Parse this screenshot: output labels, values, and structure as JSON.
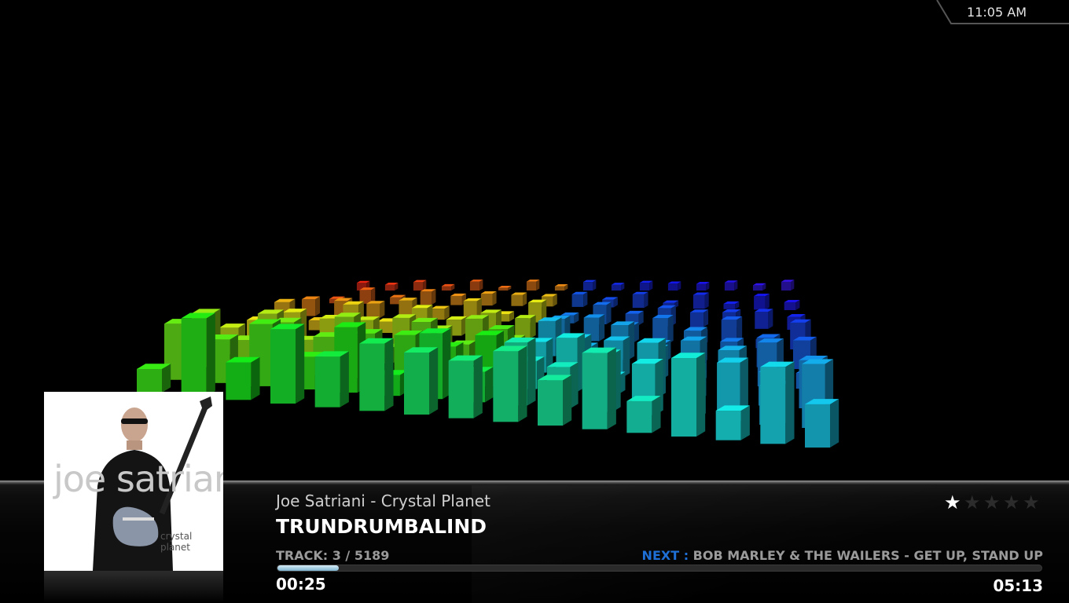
{
  "clock": {
    "time": "11:05 AM"
  },
  "album_art": {
    "artist_text": "joe satriani",
    "album_text": "crystal planet"
  },
  "now_playing": {
    "artist_album": "Joe Satriani - Crystal Planet",
    "title": "TRUNDRUMBALIND",
    "track": "TRACK: 3 / 5189",
    "next_label": "NEXT :",
    "next_song": "BOB MARLEY & THE WAILERS - GET UP, STAND UP",
    "elapsed": "00:25",
    "duration": "05:13",
    "progress": 0.08,
    "rating": 1,
    "rating_max": 5
  },
  "icons": {
    "rating": "star-icon"
  },
  "colors": {
    "next_accent": "#1e6fd6",
    "progress_fill": "#9cc8df"
  }
}
